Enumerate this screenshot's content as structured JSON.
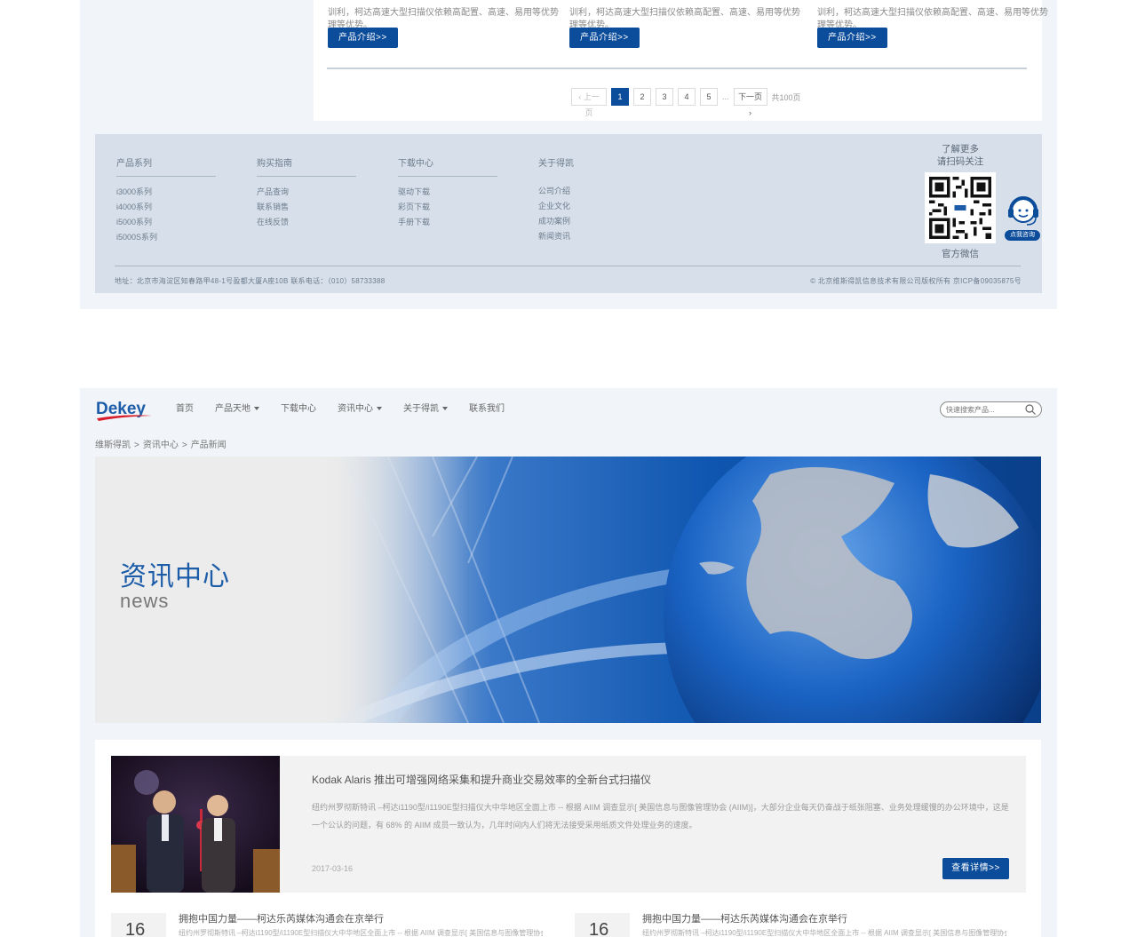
{
  "top": {
    "product_snippets": [
      {
        "line1": "训利，柯达高速大型扫描仪依赖高配置、高速、易用等优势",
        "line2": "理等优势。"
      },
      {
        "line1": "训利，柯达高速大型扫描仪依赖高配置、高速、易用等优势",
        "line2": "理等优势。"
      },
      {
        "line1": "训利，柯达高速大型扫描仪依赖高配置、高速、易用等优势",
        "line2": "理等优势。"
      }
    ],
    "product_button_label": "产品介绍>>",
    "pagination": {
      "prev": "上一页",
      "pages": [
        "1",
        "2",
        "3",
        "4",
        "5"
      ],
      "current": "1",
      "ellipsis": "...",
      "next": "下一页",
      "total": "共100页"
    }
  },
  "footer": {
    "columns": [
      {
        "title": "产品系列",
        "links": [
          "i3000系列",
          "i4000系列",
          "i5000系列",
          "i5000S系列"
        ]
      },
      {
        "title": "购买指南",
        "links": [
          "产品查询",
          "联系销售",
          "在线反馈"
        ]
      },
      {
        "title": "下载中心",
        "links": [
          "驱动下载",
          "彩页下载",
          "手册下载"
        ]
      },
      {
        "title": "关于得凯",
        "links": [
          "公司介绍",
          "企业文化",
          "成功案例",
          "新闻资讯"
        ]
      }
    ],
    "qr_heading_line1": "了解更多",
    "qr_heading_line2": "请扫码关注",
    "qr_caption": "官方微信",
    "support_label": "点我咨询",
    "address": "地址：北京市海淀区知春路甲48-1号盈都大厦A座10B    联系电话：（010）58733388",
    "copyright": "© 北京维斯得凯信息技术有限公司版权所有    京ICP备09035875号"
  },
  "header": {
    "logo_text": "Dekey",
    "nav": [
      {
        "label": "首页",
        "dropdown": false
      },
      {
        "label": "产品天地",
        "dropdown": true
      },
      {
        "label": "下载中心",
        "dropdown": false
      },
      {
        "label": "资讯中心",
        "dropdown": true
      },
      {
        "label": "关于得凯",
        "dropdown": true
      },
      {
        "label": "联系我们",
        "dropdown": false
      }
    ],
    "search_placeholder": "快速搜索产品..."
  },
  "breadcrumb": [
    "维斯得凯",
    "资讯中心",
    "产品新闻"
  ],
  "banner": {
    "title": "资讯中心",
    "subtitle": "news"
  },
  "featured_news": {
    "title": "Kodak Alaris 推出可增强网络采集和提升商业交易效率的全新台式扫描仪",
    "description": "纽约州罗彻斯特讯 –柯达i1190型/i1190E型扫描仪大中华地区全面上市 -- 根据 AIIM 调查显示[ 美国信息与图像管理协会 (AIIM)]，大部分企业每天仍奋战于纸张阻塞、业务处理缓慢的办公环境中，这是一个公认的问题，有 68% 的 AIIM 成员一致认为，几年时间内人们将无法接受采用纸质文件处理业务的速度。",
    "date": "2017-03-16",
    "button_label": "查看详情>>"
  },
  "news_list": [
    {
      "day": "16",
      "title": "拥抱中国力量——柯达乐芮媒体沟通会在京举行",
      "desc": "纽约州罗彻斯特讯 –柯达i1190型/i1190E型扫描仪大中华地区全面上市 -- 根据 AIIM 调查显示[ 美国信息与图像管理协会"
    },
    {
      "day": "16",
      "title": "拥抱中国力量——柯达乐芮媒体沟通会在京举行",
      "desc": "纽约州罗彻斯特讯 –柯达i1190型/i1190E型扫描仪大中华地区全面上市 -- 根据 AIIM 调查显示[ 美国信息与图像管理协会"
    }
  ],
  "colors": {
    "brand_blue": "#0b4c9b",
    "footer_bg": "#d7e0ea",
    "page_bg": "#f1f4f8",
    "logo_red": "#d81e2a"
  }
}
